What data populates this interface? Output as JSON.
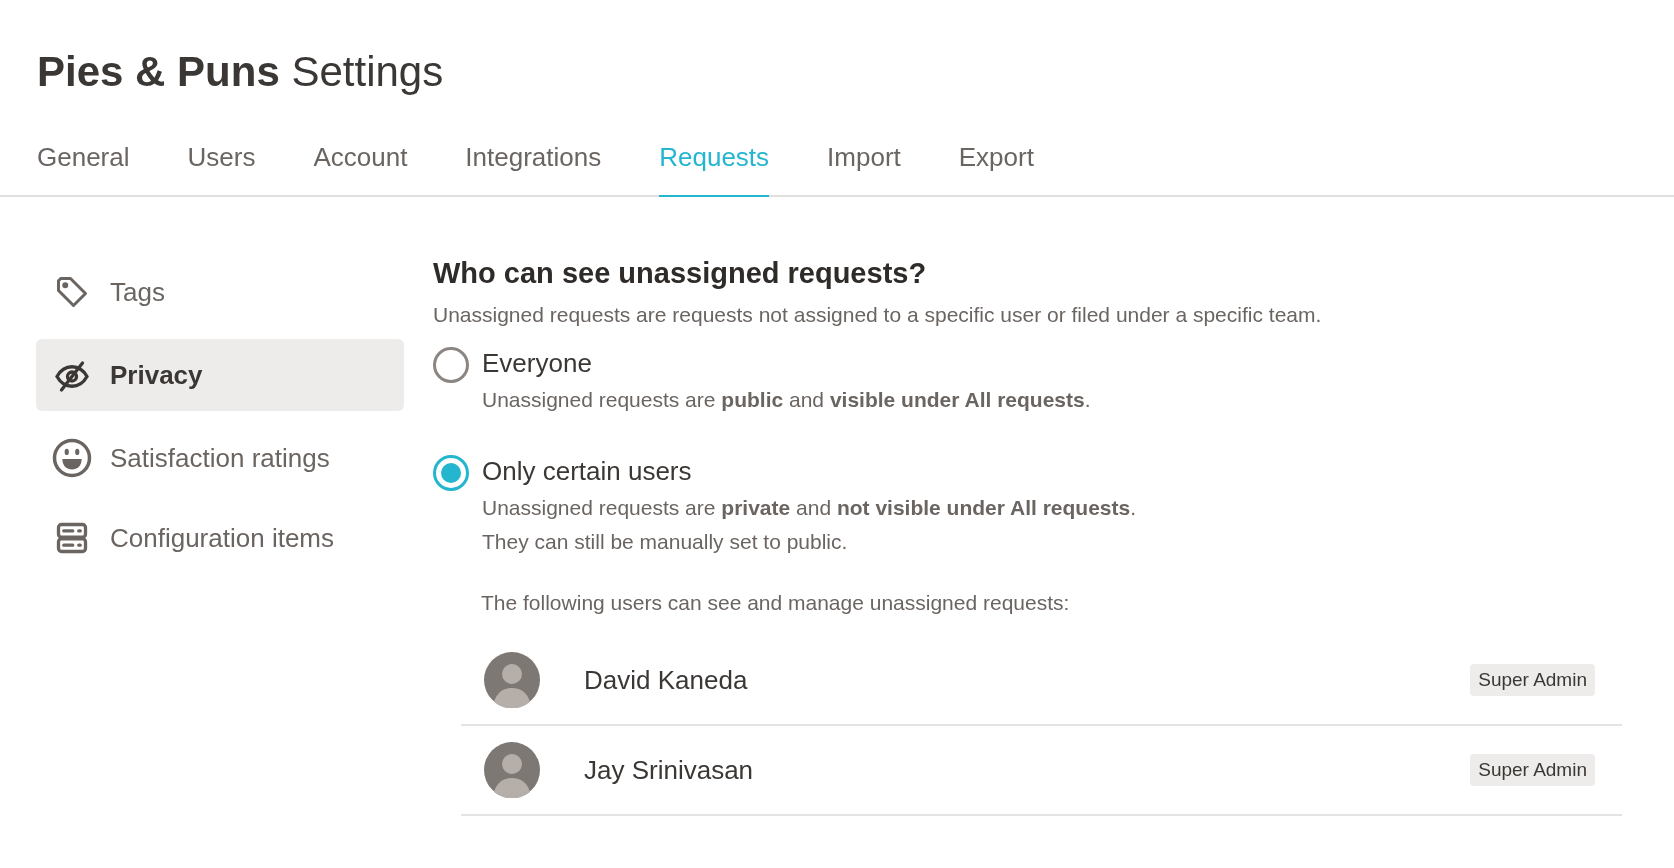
{
  "title": "**Pies & Puns** Settings",
  "tabs": [
    {
      "label": "General",
      "selected": false
    },
    {
      "label": "Users",
      "selected": false
    },
    {
      "label": "Account",
      "selected": false
    },
    {
      "label": "Integrations",
      "selected": false
    },
    {
      "label": "Requests",
      "selected": true
    },
    {
      "label": "Import",
      "selected": false
    },
    {
      "label": "Export",
      "selected": false
    }
  ],
  "sidebar": {
    "items": [
      {
        "label": "Tags",
        "kind": "tag",
        "selected": false
      },
      {
        "label": "Privacy",
        "kind": "privacy",
        "selected": true
      },
      {
        "label": "Satisfaction ratings",
        "kind": "smiley",
        "selected": false
      },
      {
        "label": "Configuration items",
        "kind": "server",
        "selected": false
      }
    ]
  },
  "section": {
    "heading": "Who can see unassigned requests?",
    "description": "Unassigned requests are requests not assigned to a specific user or filed under a specific team.",
    "options": [
      {
        "label": "Everyone",
        "selected": false,
        "details": [
          "Unassigned requests are **public** and **visible under All requests**."
        ]
      },
      {
        "label": "Only certain users",
        "selected": true,
        "details": [
          "Unassigned requests are **private** and **not visible under All requests**.",
          "They can still be manually set to public."
        ]
      }
    ],
    "users_intro": "The following users can see and manage unassigned requests:",
    "users": [
      {
        "name": "David Kaneda",
        "role": "Super Admin"
      },
      {
        "name": "Jay Srinivasan",
        "role": "Super Admin"
      }
    ]
  }
}
